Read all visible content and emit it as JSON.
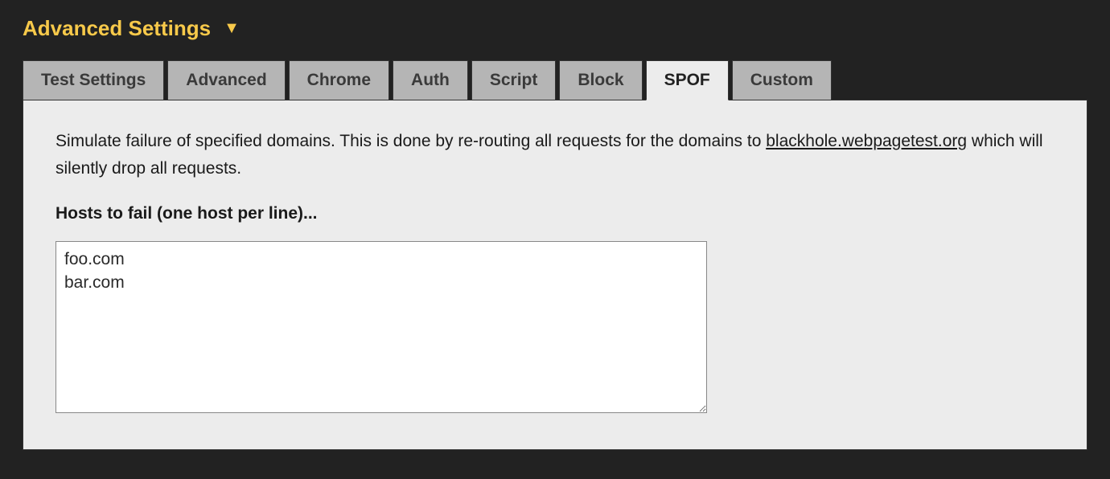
{
  "header": {
    "title": "Advanced Settings"
  },
  "tabs": [
    {
      "label": "Test Settings",
      "active": false
    },
    {
      "label": "Advanced",
      "active": false
    },
    {
      "label": "Chrome",
      "active": false
    },
    {
      "label": "Auth",
      "active": false
    },
    {
      "label": "Script",
      "active": false
    },
    {
      "label": "Block",
      "active": false
    },
    {
      "label": "SPOF",
      "active": true
    },
    {
      "label": "Custom",
      "active": false
    }
  ],
  "panel": {
    "description_pre": "Simulate failure of specified domains. This is done by re-routing all requests for the domains to ",
    "description_link": "blackhole.webpagetest.org",
    "description_post": " which will silently drop all requests.",
    "field_label": "Hosts to fail (one host per line)...",
    "hosts_value": "foo.com\nbar.com"
  }
}
